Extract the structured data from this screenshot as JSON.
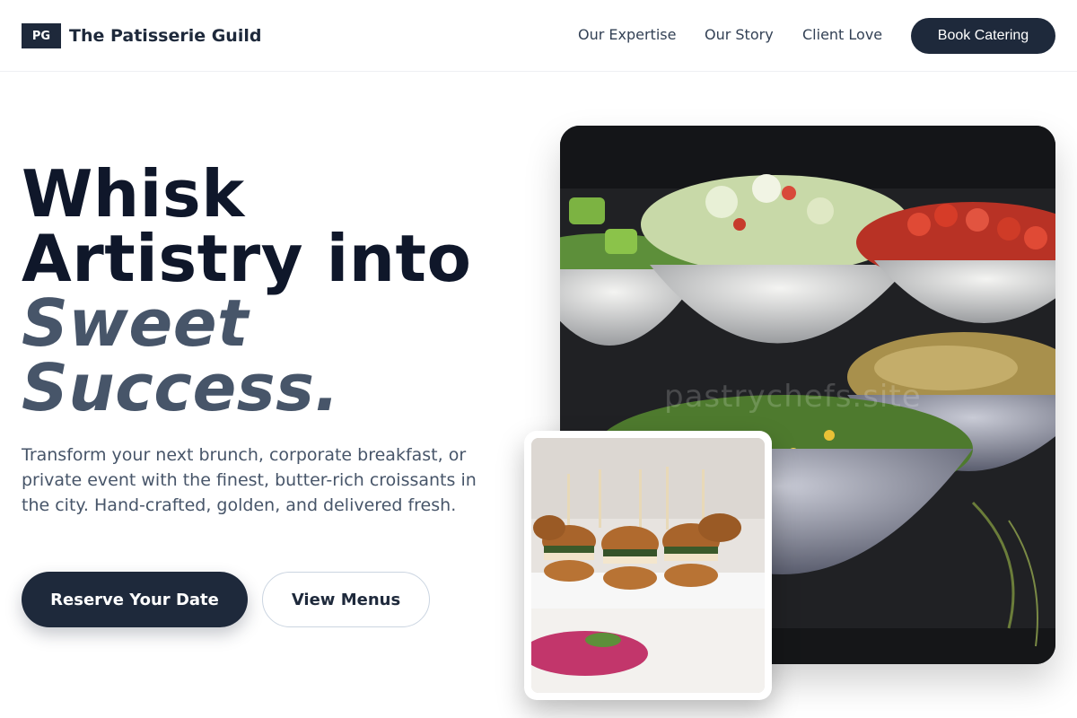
{
  "header": {
    "logo_text": "PG",
    "brand": "The Patisserie Guild",
    "nav": [
      "Our Expertise",
      "Our Story",
      "Client Love"
    ],
    "cta": "Book Catering"
  },
  "hero": {
    "headline_line1": "Whisk",
    "headline_line2": "Artistry into",
    "headline_line3": "Sweet",
    "headline_line4": "Success.",
    "subtext": "Transform your next brunch, corporate breakfast, or private event with the finest, butter-rich croissants in the city. Hand-crafted, golden, and delivered fresh.",
    "primary_button": "Reserve Your Date",
    "secondary_button": "View Menus"
  },
  "images": {
    "main_photo": "catering-salad-bowls-photo",
    "small_photo": "mini-burger-sliders-photo",
    "watermark": "pastrychefs.site"
  },
  "colors": {
    "primary": "#1e293b",
    "headline": "#0f172a",
    "accent_text": "#475569"
  }
}
